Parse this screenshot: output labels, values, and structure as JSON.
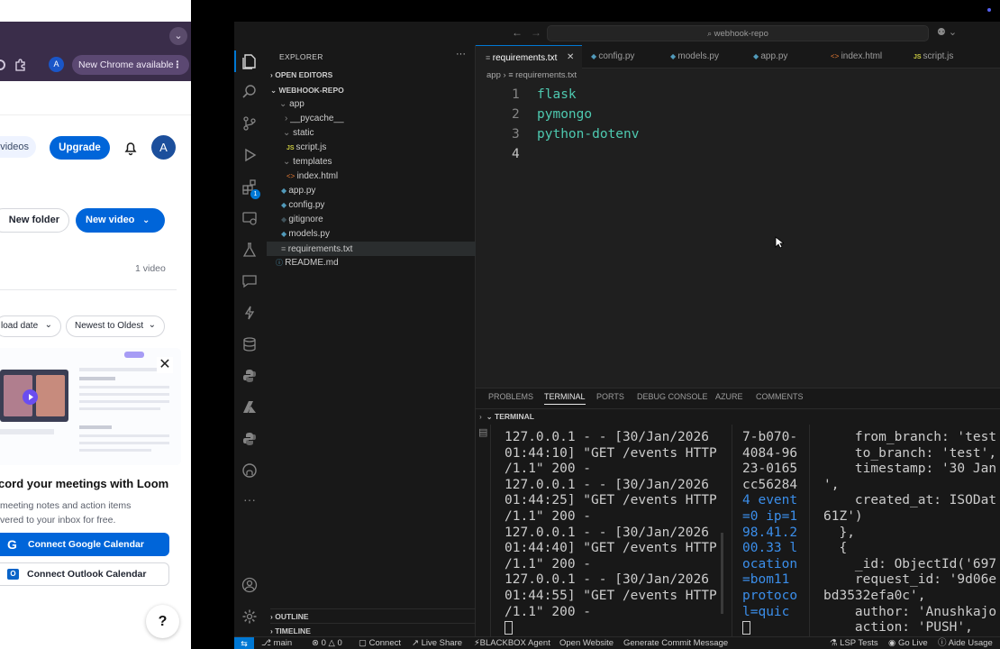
{
  "chrome": {
    "avatar_letter": "A",
    "update_label": "New Chrome available"
  },
  "loom": {
    "videos_tab": "videos",
    "upgrade_label": "Upgrade",
    "avatar_letter": "A",
    "new_folder_label": "New folder",
    "new_video_label": "New video",
    "video_count": "1 video",
    "sort_date_label": "load date",
    "sort_order_label": "Newest to Oldest",
    "promo_title": "cord your meetings with Loom",
    "promo_line1": "meeting notes and action items",
    "promo_line2": "vered to your inbox for free.",
    "google_button": "Connect Google Calendar",
    "outlook_button": "Connect Outlook Calendar",
    "help_label": "?"
  },
  "vscode": {
    "search_text": "webhook-repo",
    "explorer_title": "EXPLORER",
    "open_editors": "OPEN EDITORS",
    "repo_name": "WEBHOOK-REPO",
    "tree": [
      {
        "label": "app",
        "kind": "folder-open"
      },
      {
        "label": "__pycache__",
        "kind": "folder-closed"
      },
      {
        "label": "static",
        "kind": "folder-open"
      },
      {
        "label": "script.js",
        "kind": "js"
      },
      {
        "label": "templates",
        "kind": "folder-open"
      },
      {
        "label": "index.html",
        "kind": "html"
      },
      {
        "label": "app.py",
        "kind": "py"
      },
      {
        "label": "config.py",
        "kind": "py"
      },
      {
        "label": "gitignore",
        "kind": "git"
      },
      {
        "label": "models.py",
        "kind": "py"
      },
      {
        "label": "requirements.txt",
        "kind": "txt"
      },
      {
        "label": "README.md",
        "kind": "md"
      }
    ],
    "outline_label": "OUTLINE",
    "timeline_label": "TIMELINE",
    "tabs": [
      {
        "label": "requirements.txt",
        "icon": "txt"
      },
      {
        "label": "config.py",
        "icon": "py"
      },
      {
        "label": "models.py",
        "icon": "py"
      },
      {
        "label": "app.py",
        "icon": "py"
      },
      {
        "label": "index.html",
        "icon": "html"
      },
      {
        "label": "script.js",
        "icon": "js"
      }
    ],
    "breadcrumb": {
      "folder": "app",
      "file": "requirements.txt"
    },
    "code_lines": [
      {
        "num": "1",
        "text": "flask"
      },
      {
        "num": "2",
        "text": "pymongo"
      },
      {
        "num": "3",
        "text": "python-dotenv"
      },
      {
        "num": "4",
        "text": ""
      }
    ],
    "panel_tabs": [
      "PROBLEMS",
      "TERMINAL",
      "PORTS",
      "DEBUG CONSOLE",
      "AZURE",
      "COMMENTS"
    ],
    "terminal_header": "TERMINAL",
    "terminal1": [
      "127.0.0.1 - - [30/Jan/2026",
      "01:44:10] \"GET /events HTTP",
      "/1.1\" 200 -",
      "127.0.0.1 - - [30/Jan/2026",
      "01:44:25] \"GET /events HTTP",
      "/1.1\" 200 -",
      "127.0.0.1 - - [30/Jan/2026",
      "01:44:40] \"GET /events HTTP",
      "/1.1\" 200 -",
      "127.0.0.1 - - [30/Jan/2026",
      "01:44:55] \"GET /events HTTP",
      "/1.1\" 200 -"
    ],
    "terminal2": [
      "7-b070-",
      "4084-96",
      "23-0165",
      "cc56284",
      "4 event",
      "=0 ip=1",
      "98.41.2",
      "00.33 l",
      "ocation",
      "=bom11",
      "protoco",
      "l=quic"
    ],
    "terminal3": [
      "    from_branch: 'test",
      "    to_branch: 'test',",
      "    timestamp: '30 Jan",
      "',",
      "    created_at: ISODat",
      "61Z')",
      "  },",
      "  {",
      "    _id: ObjectId('697",
      "    request_id: '9d06e",
      "bd3532efa0c',",
      "    author: 'Anushkajo",
      "    action: 'PUSH',"
    ],
    "status": {
      "branch": "main",
      "errors": "0",
      "warnings": "0",
      "connect": "Connect",
      "live_share": "Live Share",
      "blackbox": "BLACKBOX Agent",
      "open_website": "Open Website",
      "commit": "Generate Commit Message",
      "lsp": "LSP Tests",
      "go_live": "Go Live",
      "aide": "Aide Usage"
    },
    "badge_count": "1"
  },
  "colors": {
    "accent": "#0065d9",
    "vscode_bg": "#1f1f1f",
    "sidebar_bg": "#181818",
    "code_green": "#4ec9b0",
    "python_blue": "#519aba"
  }
}
